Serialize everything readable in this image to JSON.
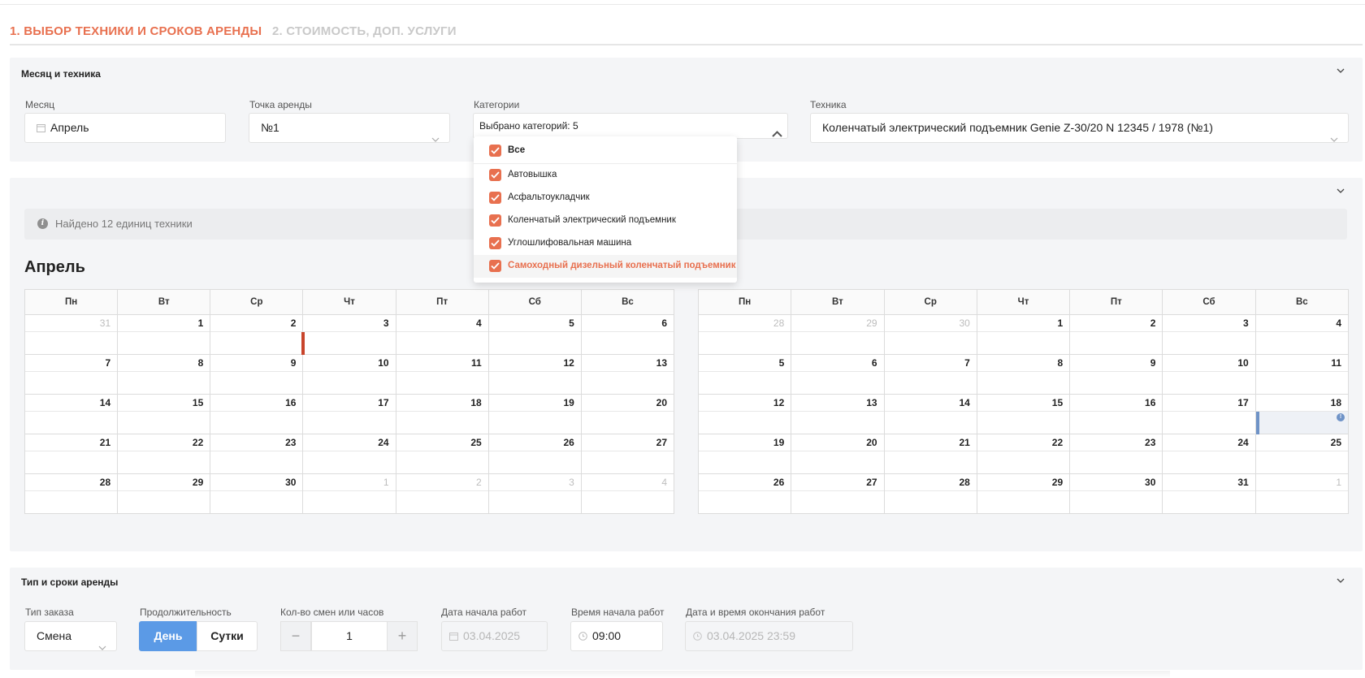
{
  "tabs": [
    {
      "label": "1. ВЫБОР ТЕХНИКИ И СРОКОВ АРЕНДЫ"
    },
    {
      "label": "2. СТОИМОСТЬ, ДОП. УСЛУГИ"
    }
  ],
  "month_panel": {
    "title": "Месяц и техника",
    "month": {
      "label": "Месяц",
      "value": "Апрель",
      "icon": "calendar-icon"
    },
    "point": {
      "label": "Точка аренды",
      "value": "№1"
    },
    "categories": {
      "label": "Категории",
      "value": "Выбрано категорий: 5"
    },
    "equipment": {
      "label": "Техника",
      "value": "Коленчатый электрический подъемник Genie Z-30/20 N 12345 / 1978 (№1)"
    }
  },
  "category_options": [
    {
      "label": "Все",
      "checked": true
    },
    {
      "label": "Автовышка",
      "checked": true
    },
    {
      "label": "Асфальтоукладчик",
      "checked": true
    },
    {
      "label": "Коленчатый электрический подъемник",
      "checked": true
    },
    {
      "label": "Углошлифовальная машина",
      "checked": true
    },
    {
      "label": "Самоходный дизельный коленчатый подъемник",
      "checked": true
    }
  ],
  "calendar_panel": {
    "info": "Найдено 12 единиц техники",
    "month_title": "Апрель",
    "weekdays": [
      "Пн",
      "Вт",
      "Ср",
      "Чт",
      "Пт",
      "Сб",
      "Вс"
    ],
    "cal1_weeks": [
      [
        "31",
        "1",
        "2",
        "3",
        "4",
        "5",
        "6"
      ],
      [
        "7",
        "8",
        "9",
        "10",
        "11",
        "12",
        "13"
      ],
      [
        "14",
        "15",
        "16",
        "17",
        "18",
        "19",
        "20"
      ],
      [
        "21",
        "22",
        "23",
        "24",
        "25",
        "26",
        "27"
      ],
      [
        "28",
        "29",
        "30",
        "1",
        "2",
        "3",
        "4"
      ]
    ],
    "cal2_weeks": [
      [
        "28",
        "29",
        "30",
        "1",
        "2",
        "3",
        "4"
      ],
      [
        "5",
        "6",
        "7",
        "8",
        "9",
        "10",
        "11"
      ],
      [
        "12",
        "13",
        "14",
        "15",
        "16",
        "17",
        "18"
      ],
      [
        "19",
        "20",
        "21",
        "22",
        "23",
        "24",
        "25"
      ],
      [
        "26",
        "27",
        "28",
        "29",
        "30",
        "31",
        "1"
      ]
    ]
  },
  "rent_panel": {
    "title": "Тип и сроки аренды",
    "order_type": {
      "label": "Тип заказа",
      "value": "Смена"
    },
    "duration": {
      "label": "Продолжительность",
      "day": "День",
      "days": "Сутки"
    },
    "shifts": {
      "label": "Кол-во смен или часов",
      "value": "1",
      "minus": "−",
      "plus": "+"
    },
    "start_date": {
      "label": "Дата начала работ",
      "value": "03.04.2025"
    },
    "start_time": {
      "label": "Время начала работ",
      "value": "09:00"
    },
    "end": {
      "label": "Дата и время окончания работ",
      "value": "03.04.2025 23:59"
    }
  },
  "colors": {
    "accent": "#e8704f",
    "primary": "#5b9ae6",
    "booking_red": "#c8442b",
    "booking_blue": "#6f93c7"
  }
}
